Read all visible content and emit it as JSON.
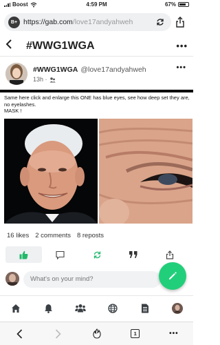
{
  "status_bar": {
    "carrier": "Boost",
    "time": "4:59 PM",
    "battery": "67%"
  },
  "browser": {
    "logo_text": "B+",
    "url_host": "https://gab.com",
    "url_path": "/love17andyahweh"
  },
  "group": {
    "title": "#WWG1WGA"
  },
  "post": {
    "group_name": "#WWG1WGA",
    "author_handle": "@love17andyahweh",
    "time_ago": "13h ·",
    "body": "Same here click and enlarge this ONE has blue eyes, see how deep set they are, no eyelashes.",
    "body_line2": "MASK !"
  },
  "stats": {
    "likes": "16 likes",
    "comments": "2 comments",
    "reposts": "8 reposts"
  },
  "composer": {
    "placeholder": "What's on your mind?"
  },
  "safari": {
    "tab_count": "1"
  },
  "colors": {
    "accent": "#21cf7a",
    "liked_bg": "#eef0f2"
  }
}
